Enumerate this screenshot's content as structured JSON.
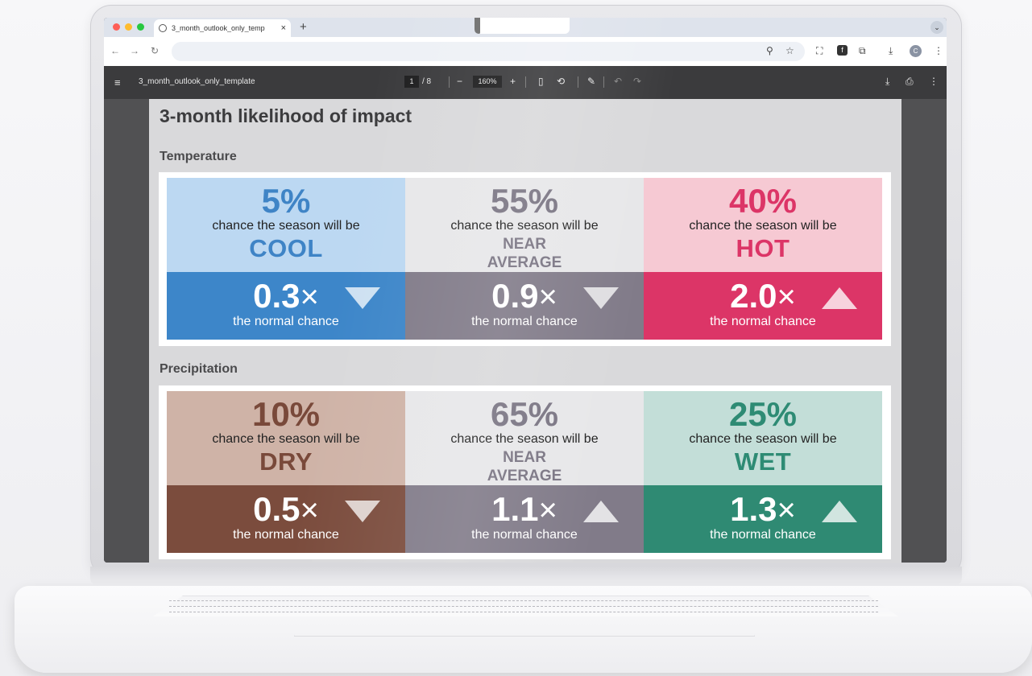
{
  "browser": {
    "tab_title": "3_month_outlook_only_temp",
    "close_label": "×",
    "new_tab_label": "+",
    "avatar_initial": "C"
  },
  "pdf_toolbar": {
    "file_name": "3_month_outlook_only_template",
    "page_current": "1",
    "page_total": "/ 8",
    "zoom": "160%",
    "zoom_out": "−",
    "zoom_in": "+"
  },
  "document": {
    "title": "3-month likelihood of impact",
    "temperature": {
      "heading": "Temperature",
      "cards": [
        {
          "pct": "5%",
          "subtitle": "chance the season will be",
          "category": "COOL",
          "multiplier": "0.3",
          "normal": "the normal chance",
          "direction": "down",
          "top_color": "#bcd8f2",
          "top_text_color": "#3f84c6",
          "bottom_color": "#3d86c9"
        },
        {
          "pct": "55%",
          "subtitle": "chance the season will be",
          "category_line1": "NEAR",
          "category_line2": "AVERAGE",
          "multiplier": "0.9",
          "normal": "the normal chance",
          "direction": "down",
          "top_color": "#e7e7e9",
          "top_text_color": "#7a7583",
          "bottom_color": "#817b89"
        },
        {
          "pct": "40%",
          "subtitle": "chance the season will be",
          "category": "HOT",
          "multiplier": "2.0",
          "normal": "the normal chance",
          "direction": "up",
          "top_color": "#f6c9d3",
          "top_text_color": "#dc3567",
          "bottom_color": "#dc3567"
        }
      ]
    },
    "precipitation": {
      "heading": "Precipitation",
      "cards": [
        {
          "pct": "10%",
          "subtitle": "chance the season will be",
          "category": "DRY",
          "multiplier": "0.5",
          "normal": "the normal chance",
          "direction": "down",
          "top_color": "#cfb3a7",
          "top_text_color": "#79493a",
          "bottom_color": "#7b4c3d"
        },
        {
          "pct": "65%",
          "subtitle": "chance the season will be",
          "category_line1": "NEAR",
          "category_line2": "AVERAGE",
          "multiplier": "1.1",
          "normal": "the normal chance",
          "direction": "up",
          "top_color": "#e7e7e9",
          "top_text_color": "#7a7583",
          "bottom_color": "#817b89"
        },
        {
          "pct": "25%",
          "subtitle": "chance the season will be",
          "category": "WET",
          "multiplier": "1.3",
          "normal": "the normal chance",
          "direction": "up",
          "top_color": "#c3ded8",
          "top_text_color": "#2e8b74",
          "bottom_color": "#2f8a73"
        }
      ]
    },
    "times_symbol": "×"
  }
}
